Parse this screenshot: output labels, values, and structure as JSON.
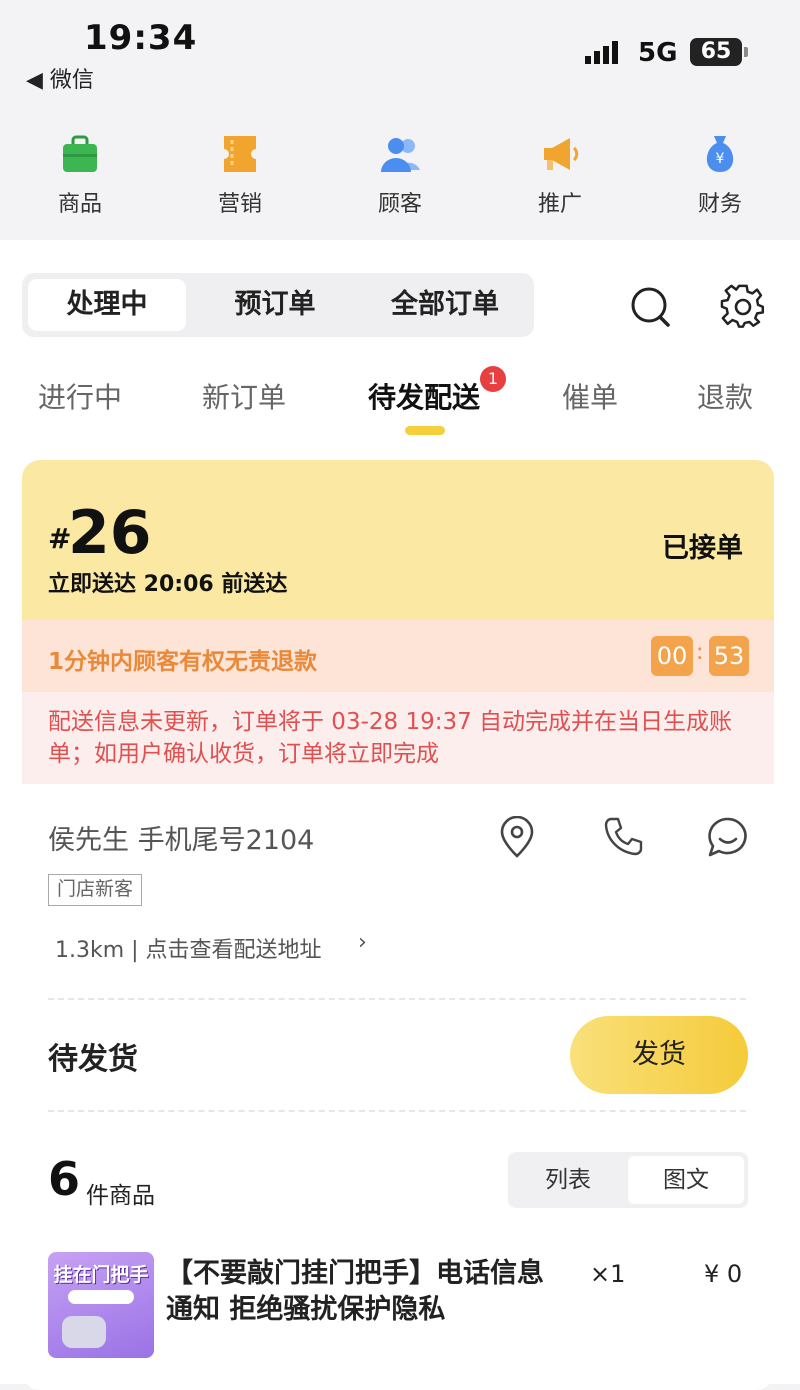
{
  "status_bar": {
    "time": "19:34",
    "back_label": "◀ 微信",
    "network": "5G",
    "battery": "65"
  },
  "top_nav": [
    {
      "label": "商品",
      "icon": "shopping-bag-icon",
      "color": "#3db551"
    },
    {
      "label": "营销",
      "icon": "ticket-icon",
      "color": "#f1a52f"
    },
    {
      "label": "顾客",
      "icon": "users-icon",
      "color": "#4b8ef0"
    },
    {
      "label": "推广",
      "icon": "megaphone-icon",
      "color": "#f1a52f"
    },
    {
      "label": "财务",
      "icon": "money-bag-icon",
      "color": "#4b8ef0"
    }
  ],
  "order_tabs": {
    "items": [
      "处理中",
      "预订单",
      "全部订单"
    ],
    "active": "处理中"
  },
  "sub_tabs": {
    "items": [
      "进行中",
      "新订单",
      "待发配送",
      "催单",
      "退款"
    ],
    "active": "待发配送",
    "badge": "1"
  },
  "order": {
    "hash": "#",
    "number": "26",
    "delivery": "立即送达 20:06 前送达",
    "status": "已接单",
    "refund_notice": "1分钟内顾客有权无责退款",
    "timer": {
      "minutes": "00",
      "colon": ":",
      "seconds": "53"
    },
    "warning": "配送信息未更新，订单将于 03-28 19:37 自动完成并在当日生成账单；如用户确认收货，订单将立即完成",
    "customer": "侯先生 手机尾号2104",
    "tag": "门店新客",
    "address_link": "1.3km | 点击查看配送地址",
    "chevron": "›",
    "pending_label": "待发货",
    "ship_button": "发货",
    "item_count": "6",
    "item_count_label": "件商品",
    "view_modes": [
      "列表",
      "图文"
    ],
    "view_active": "图文",
    "items": [
      {
        "thumb_text": "挂在门把手",
        "name": "【不要敲门挂门把手】电话信息通知 拒绝骚扰保护隐私",
        "qty": "×1",
        "price": "¥ 0"
      }
    ]
  },
  "colors": {
    "accent_yellow": "#f6cf3c",
    "badge_red": "#e84040",
    "refund_orange": "#e98a3a",
    "warning_red": "#e05050"
  }
}
